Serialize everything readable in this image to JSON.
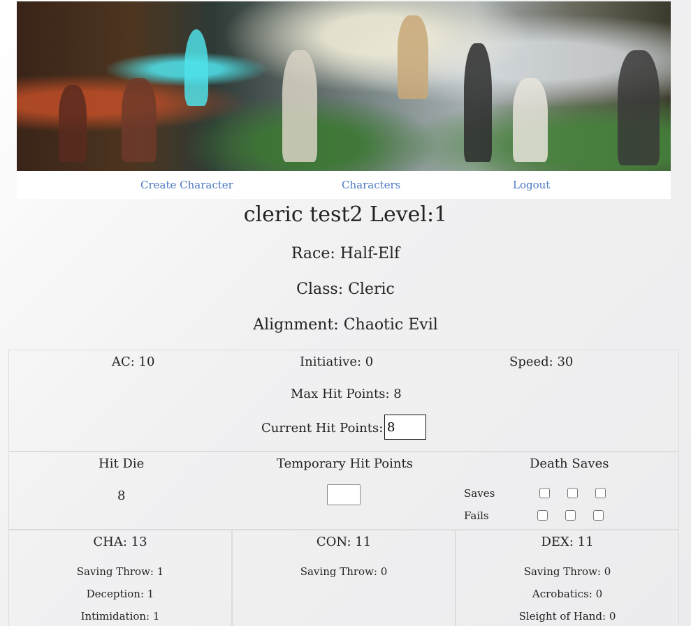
{
  "nav": {
    "create_label": "Create Character",
    "characters_label": "Characters",
    "logout_label": "Logout"
  },
  "character": {
    "heading": "cleric test2 Level:1",
    "race": "Race: Half-Elf",
    "class": "Class: Cleric",
    "alignment": "Alignment: Chaotic Evil"
  },
  "combat": {
    "ac": "AC: 10",
    "initiative": "Initiative: 0",
    "speed": "Speed: 30",
    "max_hp": "Max Hit Points: 8",
    "current_hp_label": "Current Hit Points:",
    "current_hp_value": "8"
  },
  "vitals": {
    "hit_die_label": "Hit Die",
    "hit_die_value": "8",
    "temp_hp_label": "Temporary Hit Points",
    "temp_hp_value": "",
    "death_saves_label": "Death Saves",
    "saves_label": "Saves",
    "fails_label": "Fails"
  },
  "abilities": [
    {
      "name": "CHA: 13",
      "lines": [
        "Saving Throw: 1",
        "Deception: 1",
        "Intimidation: 1"
      ]
    },
    {
      "name": "CON: 11",
      "lines": [
        "Saving Throw: 0"
      ]
    },
    {
      "name": "DEX: 11",
      "lines": [
        "Saving Throw: 0",
        "Acrobatics: 0",
        "Sleight of Hand: 0"
      ]
    }
  ]
}
